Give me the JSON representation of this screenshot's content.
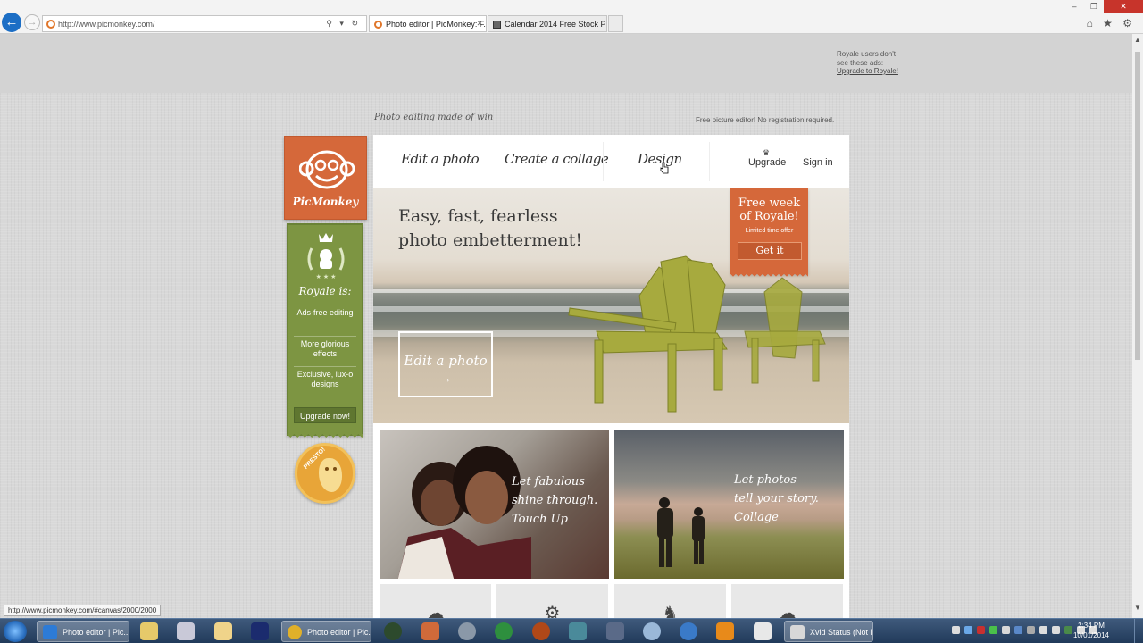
{
  "browser": {
    "url": "http://www.picmonkey.com/",
    "tabs": [
      {
        "label": "Photo editor | PicMonkey: F...",
        "active": true
      },
      {
        "label": "Calendar 2014 Free Stock Phot...",
        "active": false
      }
    ],
    "window_controls": {
      "minimize": "–",
      "restore": "❐",
      "close": "✕"
    },
    "addr_controls": "⚲ ▾ ↻",
    "tools": "⌂ ★ ⚙"
  },
  "ad_note": {
    "line1": "Royale users don't",
    "line2": "see these ads:",
    "link": "Upgrade to Royale!"
  },
  "header": {
    "tagline": "Photo editing made of win",
    "free_note": "Free picture editor! No registration required."
  },
  "logo": {
    "name": "PicMonkey"
  },
  "royale": {
    "title": "Royale is:",
    "features": [
      "Ads-free editing",
      "More glorious effects",
      "Exclusive, lux-o designs"
    ],
    "upgrade_button": "Upgrade now!"
  },
  "presto": {
    "label": "PRESTO!"
  },
  "nav": {
    "items": [
      "Edit a photo",
      "Create a collage",
      "Design"
    ],
    "upgrade": "Upgrade",
    "sign_in": "Sign in"
  },
  "hero": {
    "headline_line1": "Easy, fast, fearless",
    "headline_line2": "photo embetterment!",
    "cta": "Edit a photo",
    "cta_arrow": "→"
  },
  "promo": {
    "line1": "Free week",
    "line2": "of Royale!",
    "sub": "Limited time offer",
    "button": "Get it"
  },
  "cards": [
    {
      "lines": [
        "Let fabulous",
        "shine through.",
        "Touch Up"
      ]
    },
    {
      "lines": [
        "Let photos",
        "tell your story.",
        "Collage"
      ]
    }
  ],
  "status_tip": "http://www.picmonkey.com/#canvas/2000/2000",
  "taskbar": {
    "buttons": [
      "Photo editor | Pic...",
      "Photo editor | Pic...",
      "Xvid Status (Not R..."
    ],
    "time": "2:34 PM",
    "date": "10/01/2014"
  },
  "colors": {
    "brand_orange": "#d5683a",
    "royale_green": "#7d9542",
    "presto_gold": "#e8a538"
  }
}
